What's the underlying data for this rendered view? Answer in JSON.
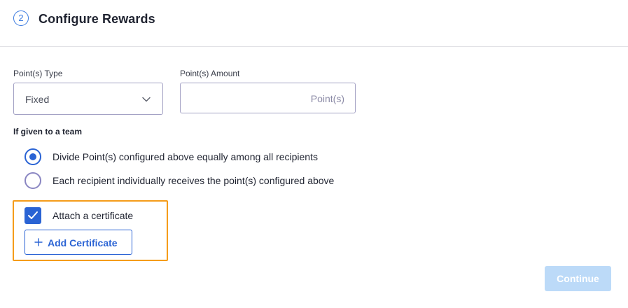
{
  "header": {
    "step_number": "2",
    "title": "Configure Rewards"
  },
  "points_type": {
    "label": "Point(s) Type",
    "selected": "Fixed"
  },
  "points_amount": {
    "label": "Point(s) Amount",
    "value": "",
    "suffix": "Point(s)"
  },
  "team": {
    "heading": "If given to a team",
    "options": [
      {
        "label": "Divide Point(s) configured above equally among all recipients",
        "checked": true
      },
      {
        "label": "Each recipient individually receives the point(s) configured above",
        "checked": false
      }
    ]
  },
  "certificate": {
    "checkbox_label": "Attach a certificate",
    "checked": true,
    "add_button_label": "Add Certificate"
  },
  "actions": {
    "continue_label": "Continue"
  },
  "colors": {
    "primary": "#2a63d4",
    "highlight_border": "#f59c1a",
    "disabled_button": "#bcdaf8"
  }
}
